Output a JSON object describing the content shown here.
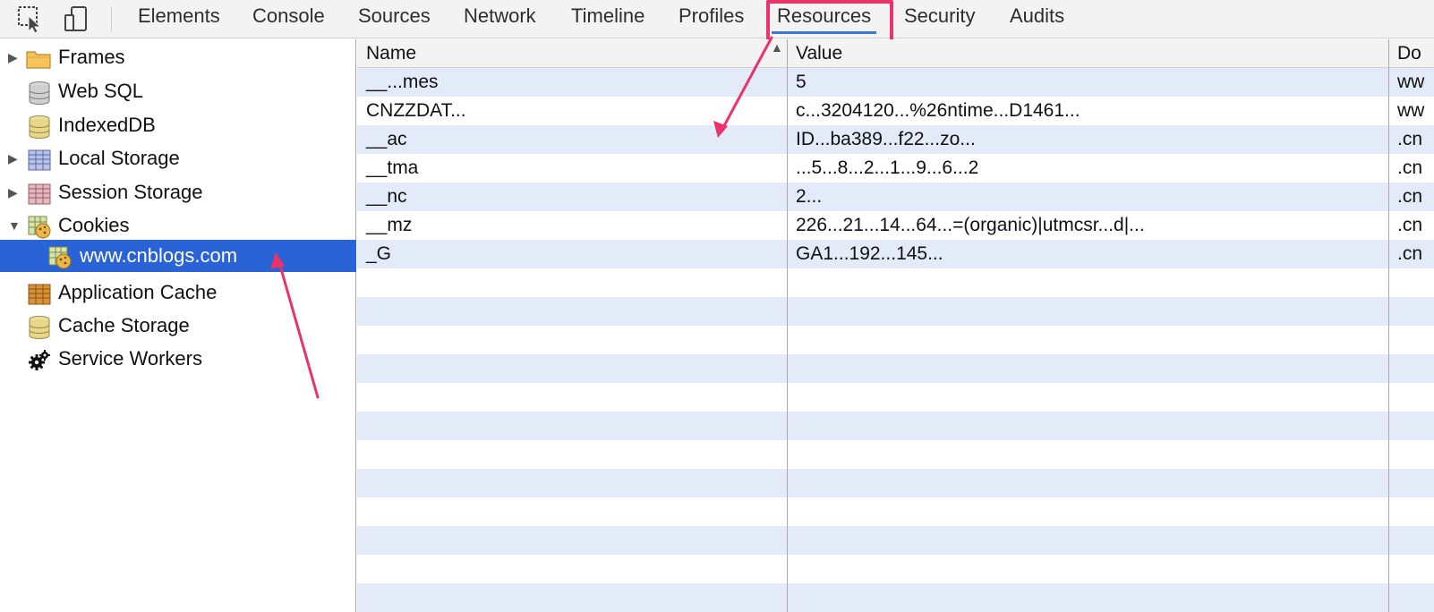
{
  "toolbar": {
    "icons": [
      "inspect-element-icon",
      "device-mode-icon"
    ],
    "tabs": [
      {
        "label": "Elements"
      },
      {
        "label": "Console"
      },
      {
        "label": "Sources"
      },
      {
        "label": "Network"
      },
      {
        "label": "Timeline"
      },
      {
        "label": "Profiles"
      },
      {
        "label": "Resources"
      },
      {
        "label": "Security"
      },
      {
        "label": "Audits"
      }
    ],
    "active_tab": "Resources"
  },
  "sidebar": {
    "items": [
      {
        "label": "Frames",
        "icon": "folder-icon",
        "expandable": "collapsed"
      },
      {
        "label": "Web SQL",
        "icon": "database-icon"
      },
      {
        "label": "IndexedDB",
        "icon": "database-icon"
      },
      {
        "label": "Local Storage",
        "icon": "table-icon",
        "expandable": "collapsed"
      },
      {
        "label": "Session Storage",
        "icon": "table-icon",
        "expandable": "collapsed"
      },
      {
        "label": "Cookies",
        "icon": "cookie-icon",
        "expandable": "expanded"
      },
      {
        "label": "www.cnblogs.com",
        "icon": "cookie-icon",
        "selected": true
      },
      {
        "label": "Application Cache",
        "icon": "app-cache-icon"
      },
      {
        "label": "Cache Storage",
        "icon": "database-icon"
      },
      {
        "label": "Service Workers",
        "icon": "gear-icon"
      }
    ]
  },
  "grid": {
    "columns": [
      "Name",
      "Value",
      "Do"
    ],
    "sort_column": "Name",
    "rows": [
      {
        "name": "__...mes",
        "value": "5",
        "domain": "ww"
      },
      {
        "name": "CNZZDAT...",
        "value": "c...3204120...%26ntime...D1461...",
        "domain": "ww"
      },
      {
        "name": "__ac",
        "value": "ID...ba389...f22...zo...",
        "domain": ".cn"
      },
      {
        "name": "__tma",
        "value": "...5...8...2...1...9...6...2",
        "domain": ".cn"
      },
      {
        "name": "__nc",
        "value": "2...",
        "domain": ".cn"
      },
      {
        "name": "__mz",
        "value": "226...21...14...64...=(organic)|utmcsr...d|...",
        "domain": ".cn"
      },
      {
        "name": "_G",
        "value": "GA1...192...145...",
        "domain": ".cn"
      }
    ]
  },
  "colors": {
    "accent": "#3879d9",
    "selected_row": "#2a63d6",
    "stripe": "#e3ebf8",
    "annotation": "#e8336b"
  }
}
